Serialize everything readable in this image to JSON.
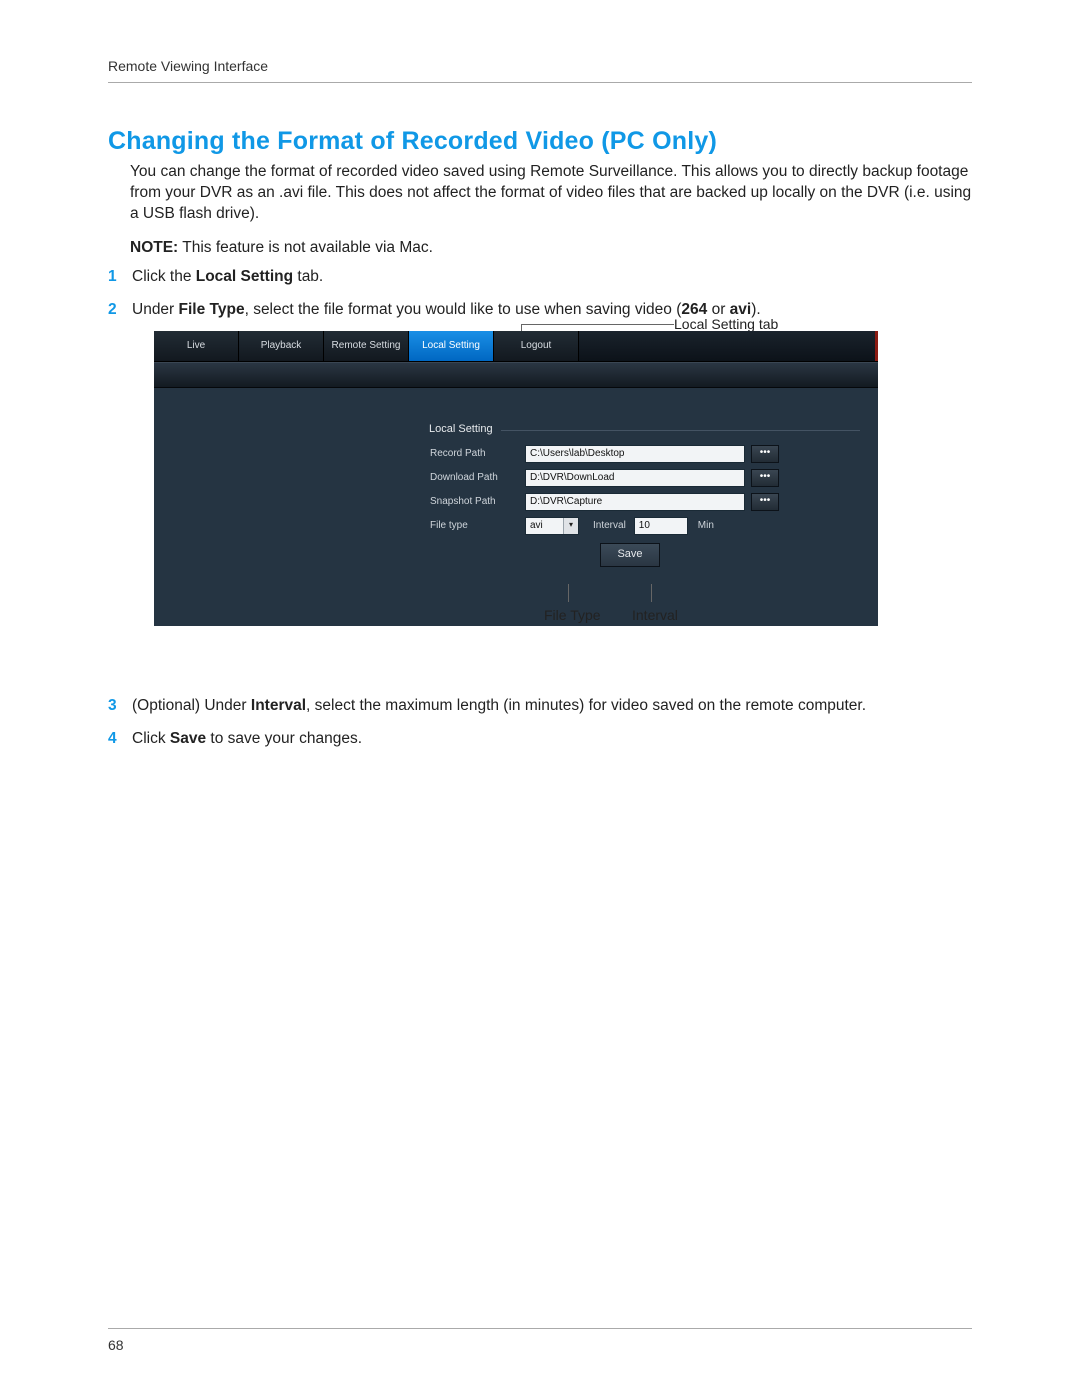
{
  "header": {
    "breadcrumb": "Remote Viewing Interface"
  },
  "title": "Changing the Format of Recorded Video (PC Only)",
  "intro": "You can change the format of recorded video saved using Remote Surveillance. This allows you to directly backup footage from your DVR as an .avi file. This does not affect the format of video files that are backed up locally on the DVR (i.e. using a USB flash drive).",
  "note_label": "NOTE:",
  "note_text": " This feature is not available via Mac.",
  "steps": {
    "s1_a": "Click the ",
    "s1_b": "Local Setting",
    "s1_c": " tab.",
    "s2_a": "Under ",
    "s2_b": "File Type",
    "s2_c": ", select the file format you would like to use when saving video (",
    "s2_d": "264",
    "s2_e": " or ",
    "s2_f": "avi",
    "s2_g": ").",
    "s3_a": "(Optional) Under ",
    "s3_b": "Interval",
    "s3_c": ", select the maximum length (in minutes) for video saved on the remote computer.",
    "s4_a": "Click ",
    "s4_b": "Save",
    "s4_c": " to save your changes."
  },
  "callouts": {
    "top": "Local Setting tab",
    "filetype": "File Type",
    "interval": "Interval"
  },
  "screenshot": {
    "tabs": {
      "live": "Live",
      "playback": "Playback",
      "remote_setting": "Remote Setting",
      "local_setting": "Local Setting",
      "logout": "Logout"
    },
    "panel_title": "Local Setting",
    "rows": {
      "record_path": {
        "label": "Record Path",
        "value": "C:\\Users\\lab\\Desktop"
      },
      "download_path": {
        "label": "Download Path",
        "value": "D:\\DVR\\DownLoad"
      },
      "snapshot_path": {
        "label": "Snapshot Path",
        "value": "D:\\DVR\\Capture"
      },
      "file_type": {
        "label": "File type",
        "value": "avi",
        "interval_label": "Interval",
        "interval_value": "10",
        "min_label": "Min"
      }
    },
    "browse_glyph": "•••",
    "save": "Save"
  },
  "footer": {
    "page": "68"
  }
}
